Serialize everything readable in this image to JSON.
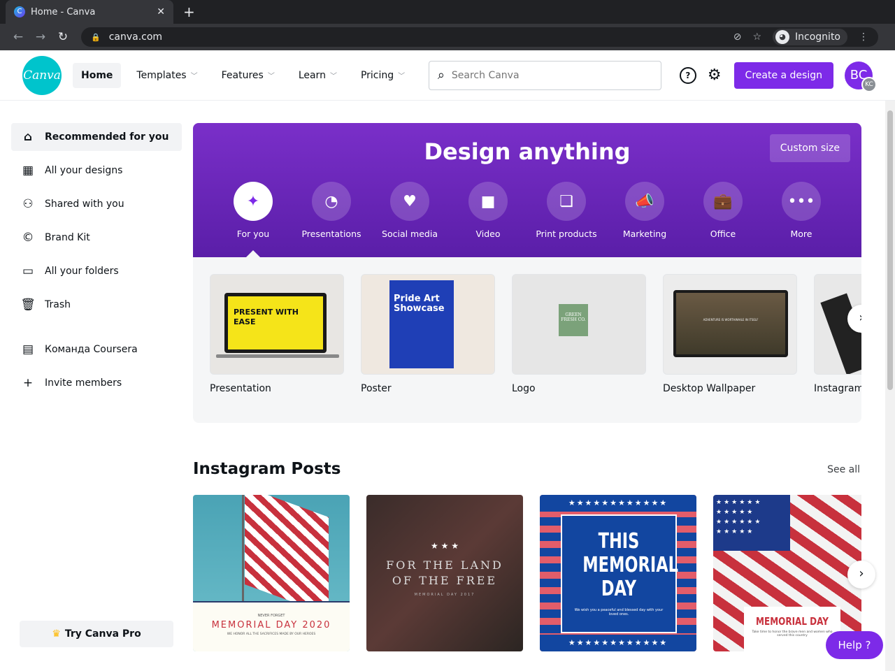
{
  "browser": {
    "tab_title": "Home - Canva",
    "favicon": "C",
    "url": "canva.com",
    "incognito_label": "Incognito"
  },
  "header": {
    "logo": "Canva",
    "nav": [
      {
        "label": "Home"
      },
      {
        "label": "Templates"
      },
      {
        "label": "Features"
      },
      {
        "label": "Learn"
      },
      {
        "label": "Pricing"
      }
    ],
    "search_placeholder": "Search Canva",
    "help_icon": "?",
    "create_label": "Create a design",
    "avatar": "BC",
    "avatar_badge": "KC"
  },
  "sidebar": {
    "items": [
      {
        "label": "Recommended for you",
        "icon": "home-icon"
      },
      {
        "label": "All your designs",
        "icon": "grid-icon"
      },
      {
        "label": "Shared with you",
        "icon": "people-icon"
      },
      {
        "label": "Brand Kit",
        "icon": "brand-icon"
      },
      {
        "label": "All your folders",
        "icon": "folder-icon"
      },
      {
        "label": "Trash",
        "icon": "trash-icon"
      }
    ],
    "team": [
      {
        "label": "Команда Coursera",
        "icon": "building-icon"
      },
      {
        "label": "Invite members",
        "icon": "plus-icon"
      }
    ],
    "try_pro": "Try Canva Pro"
  },
  "hero": {
    "title": "Design anything",
    "custom_size": "Custom size",
    "categories": [
      {
        "label": "For you"
      },
      {
        "label": "Presentations"
      },
      {
        "label": "Social media"
      },
      {
        "label": "Video"
      },
      {
        "label": "Print products"
      },
      {
        "label": "Marketing"
      },
      {
        "label": "Office"
      },
      {
        "label": "More"
      }
    ]
  },
  "templates": [
    {
      "label": "Presentation",
      "thumb_text": "PRESENT WITH EASE"
    },
    {
      "label": "Poster",
      "thumb_text": "Pride Art Showcase"
    },
    {
      "label": "Logo",
      "thumb_text": "GREEN FRESH CO."
    },
    {
      "label": "Desktop Wallpaper",
      "thumb_text": "ADVENTURE IS WORTHWHILE IN ITSELF"
    },
    {
      "label": "Instagram"
    }
  ],
  "instagram": {
    "title": "Instagram Posts",
    "see_all": "See all",
    "posts": [
      {
        "top": "NEVER FORGET",
        "title": "MEMORIAL DAY 2020",
        "sub": "WE HONOR ALL THE SACRIFICES MADE BY OUR HEROES"
      },
      {
        "stars": "★ ★ ★",
        "title": "FOR THE LAND OF THE FREE",
        "sub": "MEMORIAL DAY 2017"
      },
      {
        "title": "THIS MEMORIAL DAY",
        "sub": "We wish you a peaceful and blessed day with your loved ones."
      },
      {
        "title": "MEMORIAL DAY",
        "sub": "Take time to honor the brave men and women who served this country"
      }
    ]
  },
  "help_label": "Help  ?"
}
